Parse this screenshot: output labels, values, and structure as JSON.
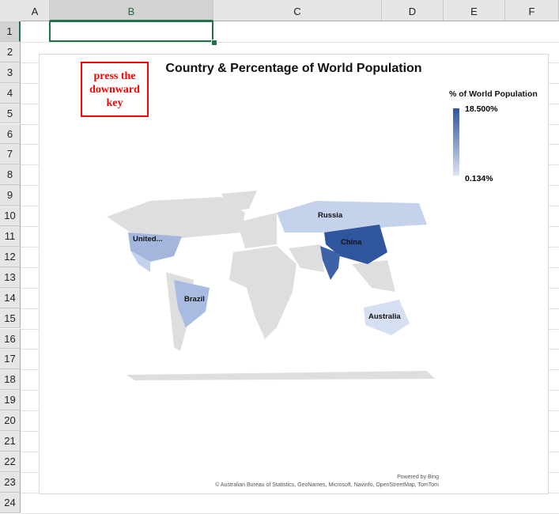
{
  "columns": [
    "A",
    "B",
    "C",
    "D",
    "E",
    "F"
  ],
  "rows": [
    "1",
    "2",
    "3",
    "4",
    "5",
    "6",
    "7",
    "8",
    "9",
    "10",
    "11",
    "12",
    "13",
    "14",
    "15",
    "16",
    "17",
    "18",
    "19",
    "20",
    "21",
    "22",
    "23",
    "24"
  ],
  "chart": {
    "title": "Country & Percentage of World Population",
    "note": "press the downward key",
    "legend": {
      "title": "% of World Population",
      "max": "18.500%",
      "min": "0.134%",
      "max_color": "#2f559c",
      "min_color": "#dbe3f3"
    },
    "labels": {
      "russia": "Russia",
      "china": "China",
      "us": "United...",
      "brazil": "Brazil",
      "australia": "Australia"
    },
    "powered": "Powered by Bing",
    "attribution": "© Australian Bureau of Statistics, GeoNames, Microsoft, Navinfo, OpenStreetMap, TomTom"
  }
}
